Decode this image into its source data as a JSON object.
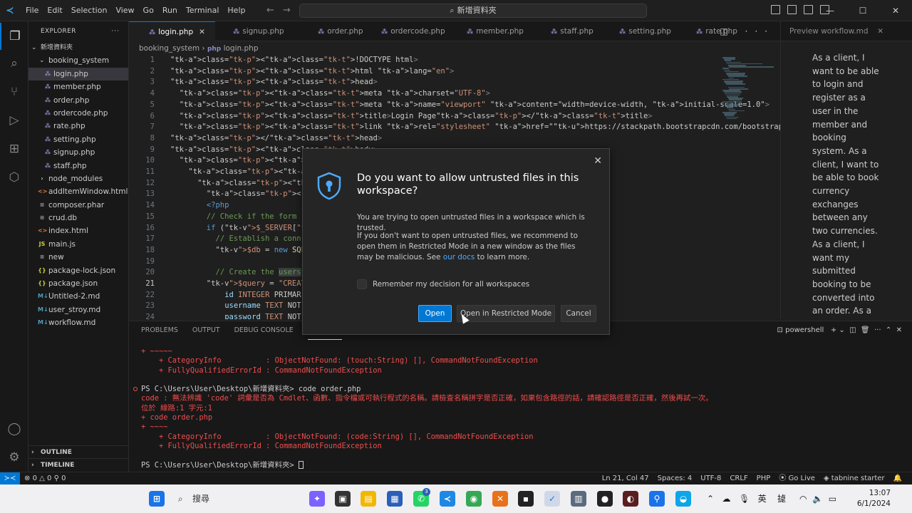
{
  "menu": [
    "File",
    "Edit",
    "Selection",
    "View",
    "Go",
    "Run",
    "Terminal",
    "Help"
  ],
  "command_center": "新增資料夾",
  "explorer": {
    "title": "EXPLORER",
    "root": "新增資料夾",
    "folder": "booking_system",
    "files_in_folder": [
      "login.php",
      "member.php",
      "order.php",
      "ordercode.php",
      "rate.php",
      "setting.php",
      "signup.php",
      "staff.php"
    ],
    "root_items": [
      {
        "name": "node_modules",
        "icon": "chevron"
      },
      {
        "name": "addItemWindow.html",
        "icon": "html"
      },
      {
        "name": "composer.phar",
        "icon": "file"
      },
      {
        "name": "crud.db",
        "icon": "file"
      },
      {
        "name": "index.html",
        "icon": "html"
      },
      {
        "name": "main.js",
        "icon": "js"
      },
      {
        "name": "new",
        "icon": "file"
      },
      {
        "name": "package-lock.json",
        "icon": "json"
      },
      {
        "name": "package.json",
        "icon": "json"
      },
      {
        "name": "Untitled-2.md",
        "icon": "md"
      },
      {
        "name": "user_stroy.md",
        "icon": "md"
      },
      {
        "name": "workflow.md",
        "icon": "md"
      }
    ],
    "outline": "OUTLINE",
    "timeline": "TIMELINE"
  },
  "tabs": [
    "login.php",
    "signup.php",
    "order.php",
    "ordercode.php",
    "member.php",
    "staff.php",
    "setting.php",
    "rate.php"
  ],
  "preview_tab": "Preview workflow.md",
  "breadcrumb": [
    "booking_system",
    "login.php"
  ],
  "code_lines": [
    {
      "n": "1",
      "text": "<!DOCTYPE html>"
    },
    {
      "n": "2",
      "text": "<html lang=\"en\">"
    },
    {
      "n": "3",
      "text": "<head>"
    },
    {
      "n": "4",
      "text": "<meta charset=\"UTF-8\">"
    },
    {
      "n": "5",
      "text": "<meta name=\"viewport\" content=\"width=device-width, initial-scale=1.0\">"
    },
    {
      "n": "6",
      "text": "<title>Login Page</title>"
    },
    {
      "n": "7",
      "text": "<link rel=\"stylesheet\" href=\"https://stackpath.bootstrapcdn.com/bootstrap/4.5.2/css/bootstrap.min.css\">"
    },
    {
      "n": "8",
      "text": "</head>"
    },
    {
      "n": "9",
      "text": "<body>"
    },
    {
      "n": "10",
      "text": "<div class=\"container\">"
    },
    {
      "n": "11",
      "text": "<div class=\"row justify-c"
    },
    {
      "n": "12",
      "text": "<div class=\"col-md-6\">"
    },
    {
      "n": "13",
      "text": "<h2 class=\"mt-5\">Logi"
    },
    {
      "n": "14",
      "text": "<?php"
    },
    {
      "n": "15",
      "text": "// Check if the form"
    },
    {
      "n": "16",
      "text": "if ($_SERVER['REQUEST"
    },
    {
      "n": "17",
      "text": "// Establish a conn"
    },
    {
      "n": "18",
      "text": "$db = new SQLite3('"
    },
    {
      "n": "19",
      "text": ""
    },
    {
      "n": "20",
      "text": "// Create the users"
    },
    {
      "n": "21",
      "text": "$query = \"CREATE TABL"
    },
    {
      "n": "22",
      "text": "id INTEGER PRIMAR"
    },
    {
      "n": "23",
      "text": "username TEXT NOT"
    },
    {
      "n": "24",
      "text": "password TEXT NOT"
    }
  ],
  "preview_text": "As a client, I want to be able to login and register as a user in the member and booking system. As a client, I want to be able to book currency exchanges between any two currencies. As a client, I want my submitted booking to be converted into an order. As a client, I want to be able to obtain",
  "panel": {
    "tabs": [
      "PROBLEMS",
      "OUTPUT",
      "DEBUG CONSOLE",
      "TERMINAL"
    ],
    "shell": "powershell"
  },
  "terminal_lines": [
    {
      "text": "+ ~~~~~",
      "kind": "err"
    },
    {
      "text": "    + CategoryInfo          : ObjectNotFound: (touch:String) [], CommandNotFoundException",
      "kind": "err"
    },
    {
      "text": "    + FullyQualifiedErrorId : CommandNotFoundException",
      "kind": "err"
    },
    {
      "text": "",
      "kind": "ok"
    },
    {
      "text": "PS C:\\Users\\User\\Desktop\\新增資料夾> code order.php",
      "kind": "prompt"
    },
    {
      "text": "code : 無法辨識 'code' 詞彙是否為 Cmdlet、函數、指令檔或可執行程式的名稱。請檢查名稱拼字是否正確，如果包含路徑的話，請確認路徑是否正確，然後再試一次。",
      "kind": "err"
    },
    {
      "text": "位於 線路:1 字元:1",
      "kind": "err"
    },
    {
      "text": "+ code order.php",
      "kind": "err"
    },
    {
      "text": "+ ~~~~",
      "kind": "err"
    },
    {
      "text": "    + CategoryInfo          : ObjectNotFound: (code:String) [], CommandNotFoundException",
      "kind": "err"
    },
    {
      "text": "    + FullyQualifiedErrorId : CommandNotFoundException",
      "kind": "err"
    },
    {
      "text": "",
      "kind": "ok"
    },
    {
      "text": "PS C:\\Users\\User\\Desktop\\新增資料夾> ",
      "kind": "cursor"
    }
  ],
  "status": {
    "errors": "0",
    "warnings": "0",
    "ports": "0",
    "position": "Ln 21, Col 47",
    "spaces": "Spaces: 4",
    "encoding": "UTF-8",
    "eol": "CRLF",
    "language": "PHP",
    "golive": "Go Live",
    "tabnine": "tabnine starter"
  },
  "dialog": {
    "title": "Do you want to allow untrusted files in this workspace?",
    "message1": "You are trying to open untrusted files in a workspace which is trusted.",
    "message2_before": "If you don't want to open untrusted files, we recommend to open them in Restricted Mode in a new window as the files may be malicious. See ",
    "message2_link": "our docs",
    "message2_after": " to learn more.",
    "checkbox_label": "Remember my decision for all workspaces",
    "btn_open": "Open",
    "btn_restricted": "Open in Restricted Mode",
    "btn_cancel": "Cancel"
  },
  "taskbar": {
    "search_placeholder": "搜尋",
    "tray_lang": "英",
    "tray_ime": "㨗",
    "time": "13:07",
    "date": "6/1/2024",
    "badge": "3"
  },
  "colors": {
    "accent": "#0078d4",
    "error": "#f14c4c",
    "link": "#4daafc"
  }
}
